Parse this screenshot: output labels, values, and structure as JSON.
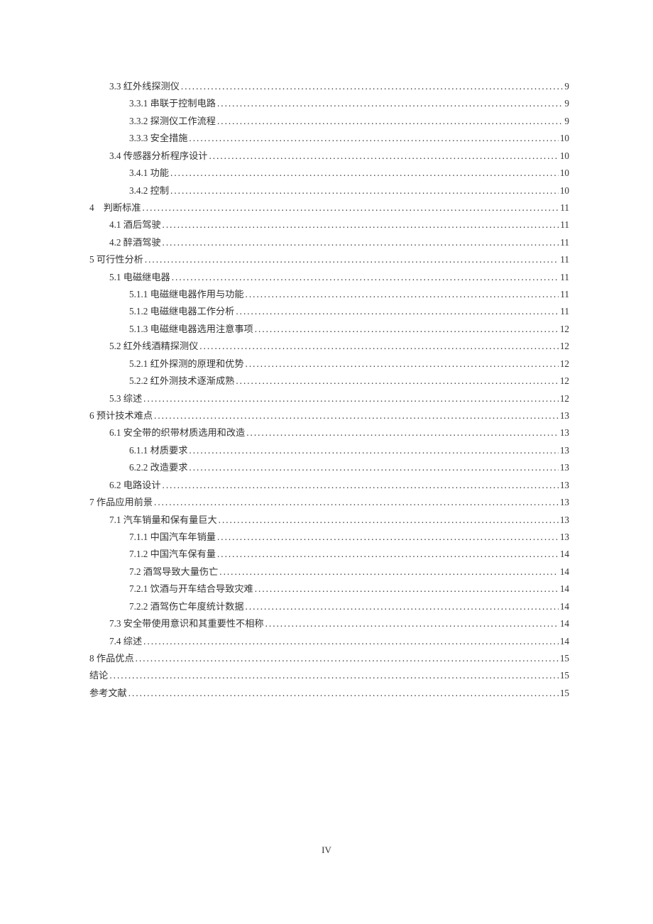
{
  "page_number": "IV",
  "toc": [
    {
      "indent": 1,
      "title": "3.3 红外线探测仪",
      "page": "9"
    },
    {
      "indent": 2,
      "title": "3.3.1 串联于控制电路",
      "page": "9"
    },
    {
      "indent": 2,
      "title": "3.3.2 探测仪工作流程",
      "page": "9"
    },
    {
      "indent": 2,
      "title": "3.3.3 安全措施",
      "page": "10"
    },
    {
      "indent": 1,
      "title": "3.4 传感器分析程序设计",
      "page": "10"
    },
    {
      "indent": 2,
      "title": "3.4.1 功能",
      "page": "10"
    },
    {
      "indent": 2,
      "title": "3.4.2 控制",
      "page": "10"
    },
    {
      "indent": 0,
      "title": "4　判断标准",
      "page": "11"
    },
    {
      "indent": 1,
      "title": "4.1 酒后驾驶",
      "page": "11"
    },
    {
      "indent": 1,
      "title": "4.2 醉酒驾驶",
      "page": "11"
    },
    {
      "indent": 0,
      "title": "5 可行性分析",
      "page": "11"
    },
    {
      "indent": 1,
      "title": "5.1 电磁继电器",
      "page": "11"
    },
    {
      "indent": 2,
      "title": "5.1.1 电磁继电器作用与功能",
      "page": "11"
    },
    {
      "indent": 2,
      "title": "5.1.2 电磁继电器工作分析",
      "page": "11"
    },
    {
      "indent": 2,
      "title": "5.1.3 电磁继电器选用注意事项",
      "page": "12"
    },
    {
      "indent": 1,
      "title": "5.2 红外线酒精探测仪",
      "page": "12"
    },
    {
      "indent": 2,
      "title": "5.2.1 红外探测的原理和优势",
      "page": "12"
    },
    {
      "indent": 2,
      "title": "5.2.2 红外测技术逐渐成熟",
      "page": "12"
    },
    {
      "indent": 1,
      "title": "5.3 综述",
      "page": "12"
    },
    {
      "indent": 0,
      "title": "6 预计技术难点",
      "page": "13"
    },
    {
      "indent": 1,
      "title": "6.1 安全带的织带材质选用和改造",
      "page": "13"
    },
    {
      "indent": 2,
      "title": "6.1.1 材质要求",
      "page": "13"
    },
    {
      "indent": 2,
      "title": "6.2.2 改造要求",
      "page": "13"
    },
    {
      "indent": 1,
      "title": "6.2 电路设计",
      "page": "13"
    },
    {
      "indent": 0,
      "title": "7 作品应用前景",
      "page": "13"
    },
    {
      "indent": 1,
      "title": "7.1 汽车销量和保有量巨大",
      "page": "13"
    },
    {
      "indent": 2,
      "title": "7.1.1 中国汽车年销量",
      "page": "13"
    },
    {
      "indent": 2,
      "title": "7.1.2 中国汽车保有量",
      "page": "14"
    },
    {
      "indent": 2,
      "title": "7.2 酒驾导致大量伤亡",
      "page": "14"
    },
    {
      "indent": 2,
      "title": "7.2.1 饮酒与开车结合导致灾难",
      "page": "14"
    },
    {
      "indent": 2,
      "title": "7.2.2 酒驾伤亡年度统计数据",
      "page": "14"
    },
    {
      "indent": 1,
      "title": "7.3 安全带使用意识和其重要性不相称",
      "page": "14"
    },
    {
      "indent": 1,
      "title": "7.4 综述",
      "page": "14"
    },
    {
      "indent": 0,
      "title": "8 作品优点",
      "page": "15"
    },
    {
      "indent": 0,
      "title": "结论",
      "page": "15"
    },
    {
      "indent": 0,
      "title": "参考文献",
      "page": "15"
    }
  ]
}
